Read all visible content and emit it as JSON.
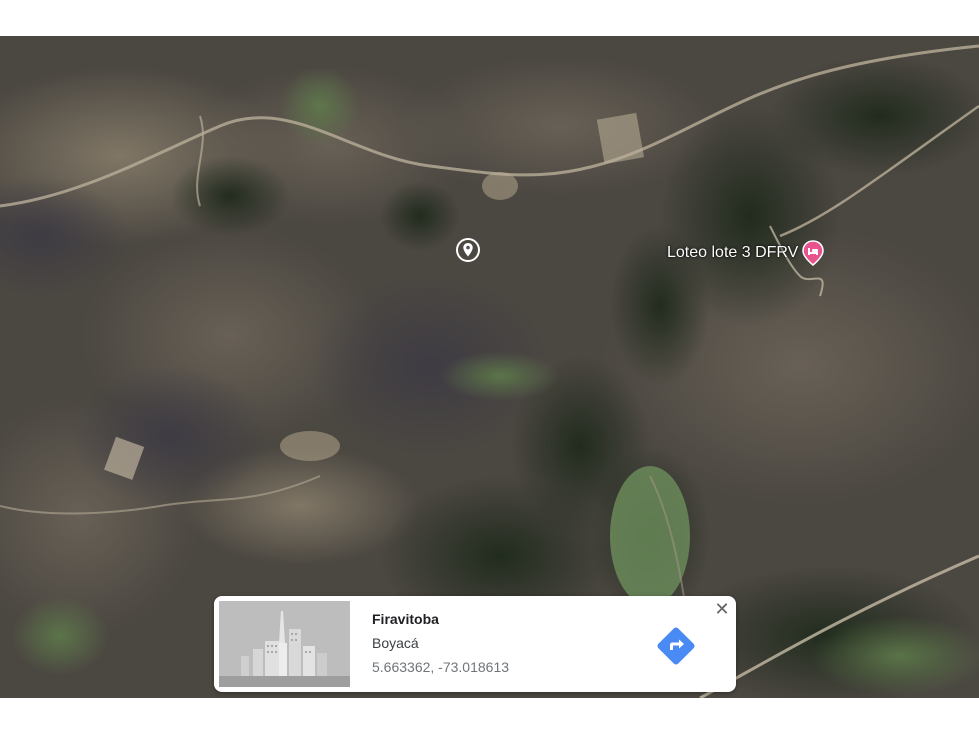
{
  "map": {
    "view": "satellite",
    "place_label": "Loteo lote 3 DFRV",
    "place_icon": "lodging-pin-icon",
    "place_icon_color": "#e8538d",
    "dropped_pin_icon": "location-pin-icon"
  },
  "info_card": {
    "title": "Firavitoba",
    "subtitle": "Boyacá",
    "coordinates": "5.663362, -73.018613",
    "close_label": "✕",
    "directions_icon": "directions-icon",
    "directions_color": "#4a8af4",
    "thumbnail_icon": "city-buildings-icon"
  }
}
